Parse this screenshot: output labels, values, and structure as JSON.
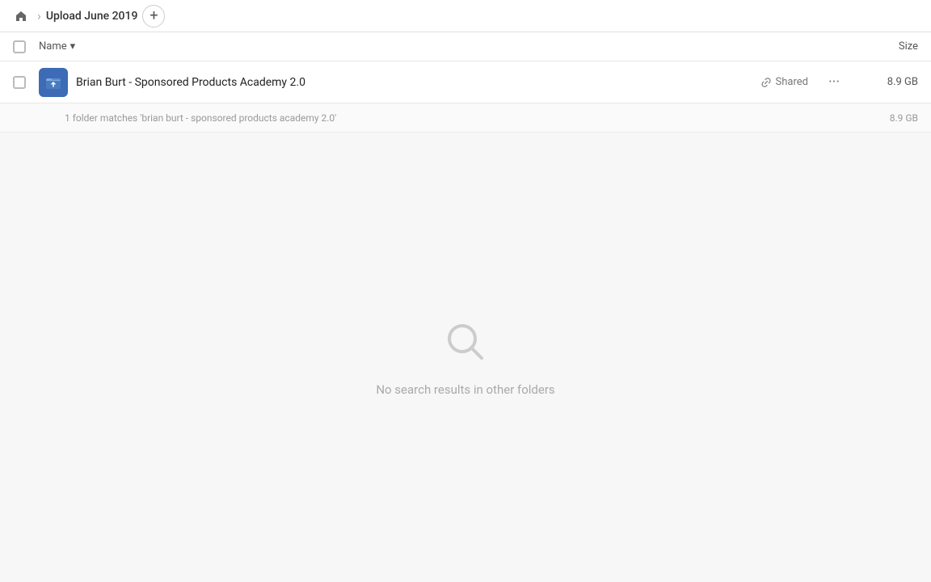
{
  "topbar": {
    "breadcrumb_label": "Upload June 2019",
    "add_button_label": "+"
  },
  "columns": {
    "name_label": "Name",
    "size_label": "Size"
  },
  "file_row": {
    "name": "Brian Burt - Sponsored Products Academy 2.0",
    "shared_label": "Shared",
    "size": "8.9 GB",
    "more_icon": "···"
  },
  "match_row": {
    "text": "1 folder matches 'brian burt - sponsored products academy 2.0'",
    "size": "8.9 GB"
  },
  "empty_state": {
    "message": "No search results in other folders"
  },
  "icons": {
    "home": "⌂",
    "separator": "›",
    "sort_arrow": "▾",
    "link": "🔗",
    "search_unicode": "⌕"
  }
}
